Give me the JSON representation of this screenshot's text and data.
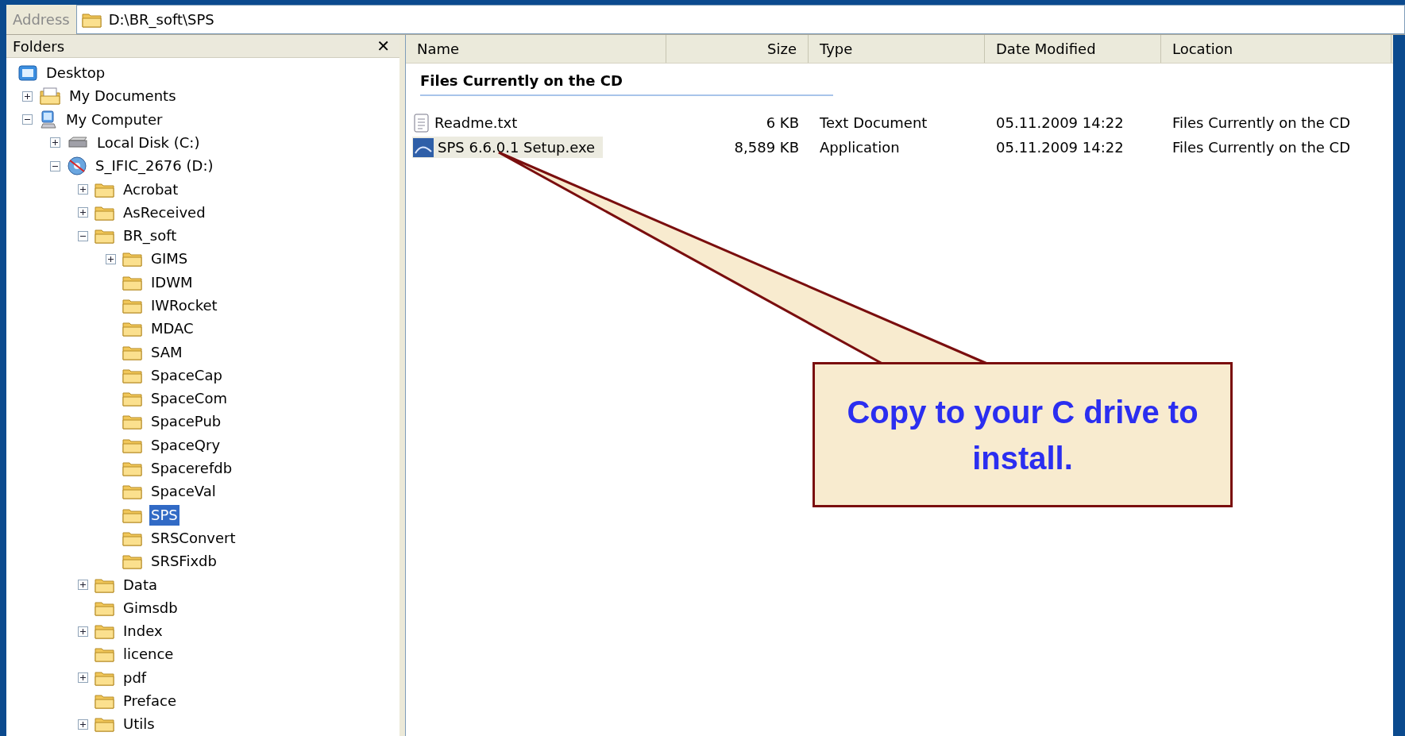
{
  "address_bar": {
    "label": "Address",
    "value": "D:\\BR_soft\\SPS"
  },
  "folders_pane": {
    "title": "Folders",
    "close": "✕",
    "tree": [
      {
        "label": "Desktop",
        "kind": "desktop",
        "selected": false,
        "children": [
          {
            "label": "My Documents",
            "kind": "documents",
            "expanded": false,
            "selected": false
          },
          {
            "label": "My Computer",
            "kind": "computer",
            "expanded": true,
            "selected": false,
            "children": [
              {
                "label": "Local Disk (C:)",
                "kind": "drive",
                "expanded": false,
                "selected": false
              },
              {
                "label": "S_IFIC_2676 (D:)",
                "kind": "cd",
                "expanded": true,
                "selected": false,
                "children": [
                  {
                    "label": "Acrobat",
                    "kind": "folder",
                    "expanded": false,
                    "selected": false
                  },
                  {
                    "label": "AsReceived",
                    "kind": "folder",
                    "expanded": false,
                    "selected": false
                  },
                  {
                    "label": "BR_soft",
                    "kind": "folder",
                    "expanded": true,
                    "selected": false,
                    "children": [
                      {
                        "label": "GIMS",
                        "kind": "folder",
                        "expanded": false,
                        "selected": false
                      },
                      {
                        "label": "IDWM",
                        "kind": "folder",
                        "selected": false
                      },
                      {
                        "label": "IWRocket",
                        "kind": "folder",
                        "selected": false
                      },
                      {
                        "label": "MDAC",
                        "kind": "folder",
                        "selected": false
                      },
                      {
                        "label": "SAM",
                        "kind": "folder",
                        "selected": false
                      },
                      {
                        "label": "SpaceCap",
                        "kind": "folder",
                        "selected": false
                      },
                      {
                        "label": "SpaceCom",
                        "kind": "folder",
                        "selected": false
                      },
                      {
                        "label": "SpacePub",
                        "kind": "folder",
                        "selected": false
                      },
                      {
                        "label": "SpaceQry",
                        "kind": "folder",
                        "selected": false
                      },
                      {
                        "label": "Spacerefdb",
                        "kind": "folder",
                        "selected": false
                      },
                      {
                        "label": "SpaceVal",
                        "kind": "folder",
                        "selected": false
                      },
                      {
                        "label": "SPS",
                        "kind": "folder",
                        "selected": true
                      },
                      {
                        "label": "SRSConvert",
                        "kind": "folder",
                        "selected": false
                      },
                      {
                        "label": "SRSFixdb",
                        "kind": "folder",
                        "selected": false
                      }
                    ]
                  },
                  {
                    "label": "Data",
                    "kind": "folder",
                    "expanded": false,
                    "selected": false
                  },
                  {
                    "label": "Gimsdb",
                    "kind": "folder",
                    "selected": false
                  },
                  {
                    "label": "Index",
                    "kind": "folder",
                    "expanded": false,
                    "selected": false
                  },
                  {
                    "label": "licence",
                    "kind": "folder",
                    "selected": false
                  },
                  {
                    "label": "pdf",
                    "kind": "folder",
                    "expanded": false,
                    "selected": false
                  },
                  {
                    "label": "Preface",
                    "kind": "folder",
                    "selected": false
                  },
                  {
                    "label": "Utils",
                    "kind": "folder",
                    "expanded": false,
                    "selected": false
                  }
                ]
              }
            ]
          }
        ]
      }
    ]
  },
  "file_list": {
    "columns": [
      "Name",
      "Size",
      "Type",
      "Date Modified",
      "Location"
    ],
    "group": "Files Currently on the CD",
    "rows": [
      {
        "kind": "text",
        "name": "Readme.txt",
        "size": "6 KB",
        "type": "Text Document",
        "date": "05.11.2009 14:22",
        "location": "Files Currently on the CD",
        "selected": false
      },
      {
        "kind": "app",
        "name": "SPS 6.6.0.1 Setup.exe",
        "size": "8,589 KB",
        "type": "Application",
        "date": "05.11.2009 14:22",
        "location": "Files Currently on the CD",
        "selected": true
      }
    ]
  },
  "callout": {
    "text": "Copy to your C drive to install."
  }
}
